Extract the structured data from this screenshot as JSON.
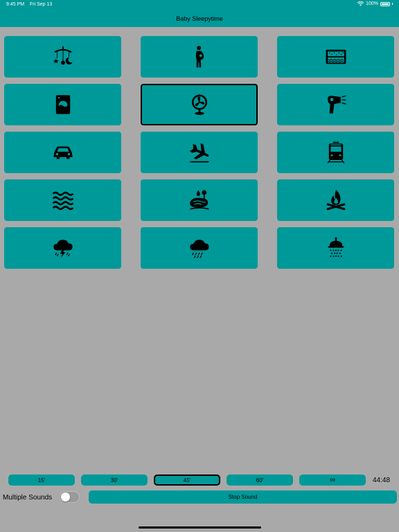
{
  "status": {
    "time": "9:45 PM",
    "date": "Fri Sep 13",
    "battery": "100%"
  },
  "app": {
    "title": "Baby Sleepytime"
  },
  "sounds": [
    {
      "icon": "baby-mobile-icon"
    },
    {
      "icon": "pregnant-woman-icon"
    },
    {
      "icon": "white-noise-icon"
    },
    {
      "icon": "washing-machine-icon"
    },
    {
      "icon": "fan-icon",
      "selected": true
    },
    {
      "icon": "hair-dryer-icon"
    },
    {
      "icon": "car-icon"
    },
    {
      "icon": "airplane-icon"
    },
    {
      "icon": "train-icon"
    },
    {
      "icon": "ocean-waves-icon"
    },
    {
      "icon": "pond-rain-icon"
    },
    {
      "icon": "campfire-icon"
    },
    {
      "icon": "thunderstorm-icon"
    },
    {
      "icon": "rain-cloud-icon"
    },
    {
      "icon": "shower-icon"
    }
  ],
  "timer": {
    "options": [
      "15'",
      "30'",
      "45'",
      "60'",
      "∞"
    ],
    "selected": "45'",
    "remaining": "44:48"
  },
  "controls": {
    "multiple_sounds_label": "Multiple Sounds",
    "multiple_sounds_on": false,
    "stop_label": "Stop Sound"
  },
  "colors": {
    "accent": "#009999",
    "background": "#a9a9a9"
  }
}
